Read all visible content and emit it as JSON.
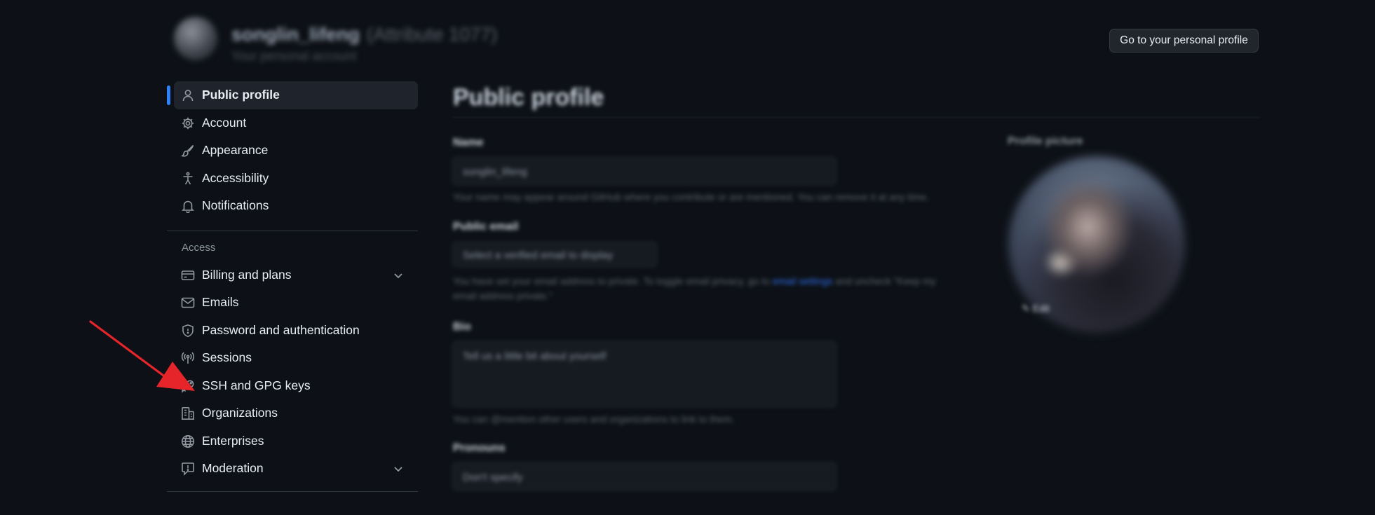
{
  "header": {
    "username": "songlin_lifeng",
    "username_suffix": "(Attribute 1077)",
    "subtitle": "Your personal account",
    "profile_button": "Go to your personal profile"
  },
  "sidebar": {
    "items": [
      {
        "label": "Public profile",
        "icon": "person-icon",
        "active": true
      },
      {
        "label": "Account",
        "icon": "gear-icon"
      },
      {
        "label": "Appearance",
        "icon": "paintbrush-icon"
      },
      {
        "label": "Accessibility",
        "icon": "accessibility-icon"
      },
      {
        "label": "Notifications",
        "icon": "bell-icon"
      }
    ],
    "access_title": "Access",
    "access_items": [
      {
        "label": "Billing and plans",
        "icon": "credit-card-icon",
        "chevron": true
      },
      {
        "label": "Emails",
        "icon": "mail-icon"
      },
      {
        "label": "Password and authentication",
        "icon": "shield-lock-icon"
      },
      {
        "label": "Sessions",
        "icon": "broadcast-icon"
      },
      {
        "label": "SSH and GPG keys",
        "icon": "key-icon"
      },
      {
        "label": "Organizations",
        "icon": "organization-icon"
      },
      {
        "label": "Enterprises",
        "icon": "globe-icon"
      },
      {
        "label": "Moderation",
        "icon": "report-icon",
        "chevron": true
      }
    ]
  },
  "main": {
    "title": "Public profile",
    "name_label": "Name",
    "name_value": "songlin_lifeng",
    "name_note": "Your name may appear around GitHub where you contribute or are mentioned. You can remove it at any time.",
    "email_label": "Public email",
    "email_placeholder": "Select a verified email to display",
    "email_note_1": "You have set your email address to private. To toggle email privacy, go to",
    "email_note_link": "email settings",
    "email_note_2": "and uncheck \"Keep my",
    "email_note_3": "email address private.\"",
    "bio_label": "Bio",
    "bio_placeholder": "Tell us a little bit about yourself",
    "bio_note": "You can @mention other users and organizations to link to them.",
    "pronouns_label": "Pronouns",
    "pronouns_value": "Don't specify",
    "picture_label": "Profile picture",
    "edit_label": "Edit"
  },
  "colors": {
    "background": "#0d1117",
    "accent": "#2f81f7",
    "annotation_arrow": "#e5252a"
  }
}
